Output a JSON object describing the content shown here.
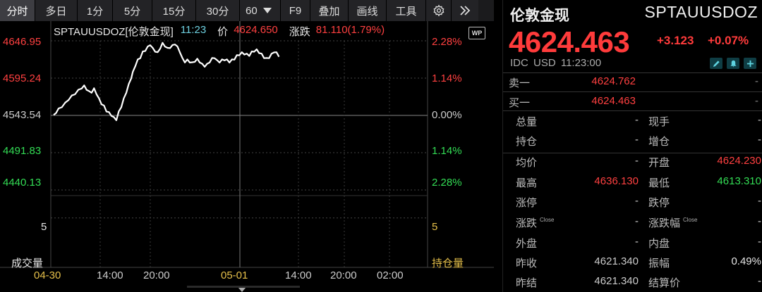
{
  "colors": {
    "up": "#ff4040",
    "down": "#33dd55",
    "accent_time": "#6ed0e0",
    "volume_label": "#e6c04a",
    "background": "#000000"
  },
  "toolbar": {
    "items": [
      {
        "label": "分时",
        "active": true
      },
      {
        "label": "多日"
      },
      {
        "label": "1分"
      },
      {
        "label": "5分"
      },
      {
        "label": "15分"
      },
      {
        "label": "30分"
      },
      {
        "label": "60"
      },
      {
        "label": "F9"
      },
      {
        "label": "叠加"
      },
      {
        "label": "画线"
      },
      {
        "label": "工具"
      }
    ],
    "dropdown_icon": "caret-down-icon",
    "settings_icon": "gear-icon",
    "expand_icon": "double-chevron-right-icon"
  },
  "chart": {
    "code_name": "SPTAUUSDOZ[伦敦金现]",
    "time": "11:23",
    "price_label": "价",
    "price": "4624.650",
    "change_label": "涨跌",
    "change": "81.110(1.79%)",
    "badge": "WP",
    "price_axis": [
      "4646.95",
      "4595.24",
      "4543.54",
      "4491.83",
      "4440.13"
    ],
    "pct_axis": [
      "2.28%",
      "1.14%",
      "0.00%",
      "1.14%",
      "2.28%"
    ],
    "volume_axis_left": "5",
    "volume_axis_right": "5",
    "volume_label": "成交量",
    "open_interest_label": "持仓量",
    "time_axis": [
      "04-30",
      "14:00",
      "20:00",
      "05-01",
      "14:00",
      "20:00",
      "02:00"
    ]
  },
  "chart_data": {
    "type": "line",
    "title": "SPTAUUSDOZ[伦敦金现]",
    "x_labels": [
      "04-30",
      "14:00",
      "20:00",
      "05-01",
      "14:00",
      "20:00",
      "02:00"
    ],
    "ylim": [
      4440.13,
      4646.95
    ],
    "baseline": 4543.54,
    "series": [
      {
        "name": "",
        "points": [
          [
            0,
            4543
          ],
          [
            3,
            4548
          ],
          [
            6,
            4552
          ],
          [
            10,
            4556
          ],
          [
            14,
            4560
          ],
          [
            18,
            4566
          ],
          [
            22,
            4570
          ],
          [
            26,
            4574
          ],
          [
            30,
            4578
          ],
          [
            34,
            4582
          ],
          [
            37,
            4584
          ],
          [
            40,
            4580
          ],
          [
            43,
            4576
          ],
          [
            46,
            4576
          ],
          [
            49,
            4580
          ],
          [
            52,
            4574
          ],
          [
            55,
            4566
          ],
          [
            58,
            4560
          ],
          [
            61,
            4556
          ],
          [
            64,
            4550
          ],
          [
            67,
            4547
          ],
          [
            70,
            4544
          ],
          [
            73,
            4540
          ],
          [
            76,
            4538
          ],
          [
            79,
            4548
          ],
          [
            82,
            4556
          ],
          [
            85,
            4566
          ],
          [
            88,
            4576
          ],
          [
            91,
            4586
          ],
          [
            94,
            4596
          ],
          [
            96,
            4603
          ],
          [
            99,
            4613
          ],
          [
            102,
            4620
          ],
          [
            105,
            4624
          ],
          [
            108,
            4631
          ],
          [
            111,
            4634
          ],
          [
            114,
            4638
          ],
          [
            117,
            4642
          ],
          [
            120,
            4636
          ],
          [
            123,
            4633
          ],
          [
            126,
            4630
          ],
          [
            129,
            4637
          ],
          [
            132,
            4643
          ],
          [
            135,
            4640
          ],
          [
            138,
            4636
          ],
          [
            141,
            4638
          ],
          [
            144,
            4640
          ],
          [
            147,
            4643
          ],
          [
            150,
            4638
          ],
          [
            153,
            4632
          ],
          [
            156,
            4622
          ],
          [
            159,
            4618
          ],
          [
            162,
            4620
          ],
          [
            165,
            4618
          ],
          [
            168,
            4616
          ],
          [
            171,
            4619
          ],
          [
            174,
            4621
          ],
          [
            177,
            4618
          ],
          [
            180,
            4614
          ],
          [
            183,
            4612
          ],
          [
            186,
            4614
          ],
          [
            189,
            4618
          ],
          [
            192,
            4622
          ],
          [
            195,
            4624
          ],
          [
            198,
            4619
          ],
          [
            201,
            4618
          ],
          [
            204,
            4620
          ],
          [
            207,
            4621
          ],
          [
            210,
            4620
          ],
          [
            213,
            4618
          ],
          [
            216,
            4620
          ],
          [
            219,
            4622
          ],
          [
            222,
            4626
          ],
          [
            225,
            4628
          ],
          [
            228,
            4630
          ],
          [
            231,
            4629
          ],
          [
            234,
            4628
          ],
          [
            237,
            4627
          ],
          [
            240,
            4631
          ],
          [
            243,
            4633
          ],
          [
            246,
            4634
          ],
          [
            249,
            4631
          ],
          [
            252,
            4628
          ],
          [
            255,
            4624
          ],
          [
            258,
            4622
          ],
          [
            261,
            4624
          ],
          [
            264,
            4628
          ],
          [
            267,
            4632
          ],
          [
            270,
            4630
          ],
          [
            273,
            4626
          ]
        ]
      }
    ],
    "grid": true
  },
  "panel": {
    "name": "伦敦金现",
    "code": "SPTAUUSDOZ",
    "price": "4624.463",
    "change": "+3.123",
    "change_pct": "+0.07%",
    "meta": "IDC  USD  11:23:00",
    "icons": [
      "pencil-icon",
      "bell-icon",
      "plus-icon"
    ],
    "ask_label": "卖一",
    "ask_value": "4624.762",
    "ask_size": "-",
    "bid_label": "买一",
    "bid_value": "4624.463",
    "bid_size": "-",
    "stats": [
      {
        "l1": "总量",
        "v1": "-",
        "l2": "现手",
        "v2": "-"
      },
      {
        "l1": "持仓",
        "v1": "-",
        "l2": "增仓",
        "v2": "-"
      },
      {
        "l1": "均价",
        "v1": "-",
        "l2": "开盘",
        "v2": "4624.230",
        "v2c": "red"
      },
      {
        "l1": "最高",
        "v1": "4636.130",
        "v1c": "red",
        "l2": "最低",
        "v2": "4613.310",
        "v2c": "green"
      },
      {
        "l1": "涨停",
        "v1": "-",
        "l2": "跌停",
        "v2": "-"
      },
      {
        "l1": "涨跌",
        "s1": "Close",
        "v1": "-",
        "l2": "涨跌幅",
        "s2": "Close",
        "v2": "-"
      },
      {
        "l1": "外盘",
        "v1": "-",
        "l2": "内盘",
        "v2": "-"
      },
      {
        "l1": "昨收",
        "v1": "4621.340",
        "l2": "振幅",
        "v2": "0.49%",
        "v2c": "white"
      },
      {
        "l1": "昨结",
        "v1": "4621.340",
        "l2": "结算价",
        "v2": "-"
      }
    ]
  }
}
